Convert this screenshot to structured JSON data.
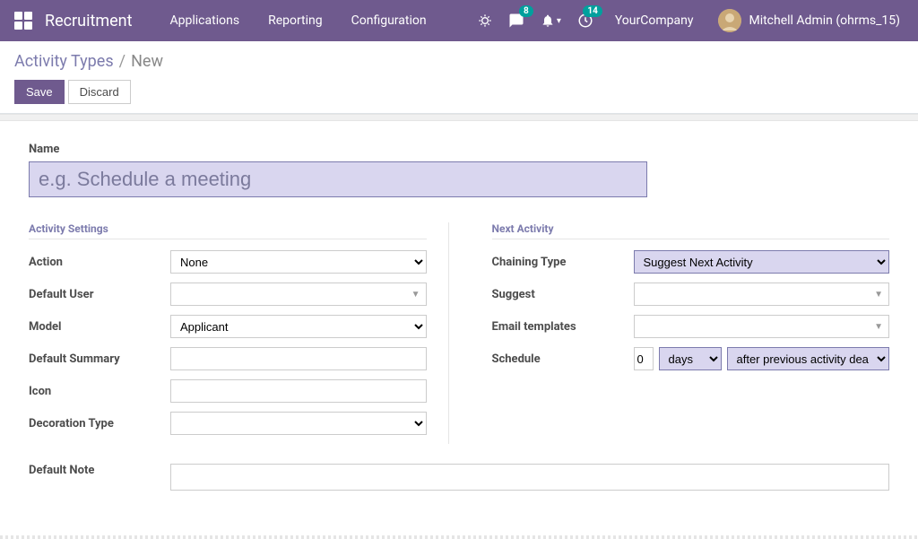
{
  "navbar": {
    "brand": "Recruitment",
    "links": {
      "applications": "Applications",
      "reporting": "Reporting",
      "configuration": "Configuration"
    },
    "badges": {
      "messages": "8",
      "activities": "14"
    },
    "company": "YourCompany",
    "user": "Mitchell Admin (ohrms_15)"
  },
  "breadcrumb": {
    "parent": "Activity Types",
    "sep": "/",
    "current": "New"
  },
  "buttons": {
    "save": "Save",
    "discard": "Discard"
  },
  "title_section": {
    "label": "Name",
    "placeholder": "e.g. Schedule a meeting",
    "value": ""
  },
  "activity_settings": {
    "section_title": "Activity Settings",
    "action": {
      "label": "Action",
      "value": "None"
    },
    "default_user": {
      "label": "Default User",
      "value": ""
    },
    "model": {
      "label": "Model",
      "value": "Applicant"
    },
    "default_summary": {
      "label": "Default Summary",
      "value": ""
    },
    "icon": {
      "label": "Icon",
      "value": ""
    },
    "decoration_type": {
      "label": "Decoration Type",
      "value": ""
    }
  },
  "next_activity": {
    "section_title": "Next Activity",
    "chaining_type": {
      "label": "Chaining Type",
      "value": "Suggest Next Activity"
    },
    "suggest": {
      "label": "Suggest",
      "value": ""
    },
    "email_templates": {
      "label": "Email templates",
      "value": ""
    },
    "schedule": {
      "label": "Schedule",
      "count": "0",
      "unit": "days",
      "basis": "after previous activity deadline"
    }
  },
  "default_note": {
    "label": "Default Note"
  }
}
